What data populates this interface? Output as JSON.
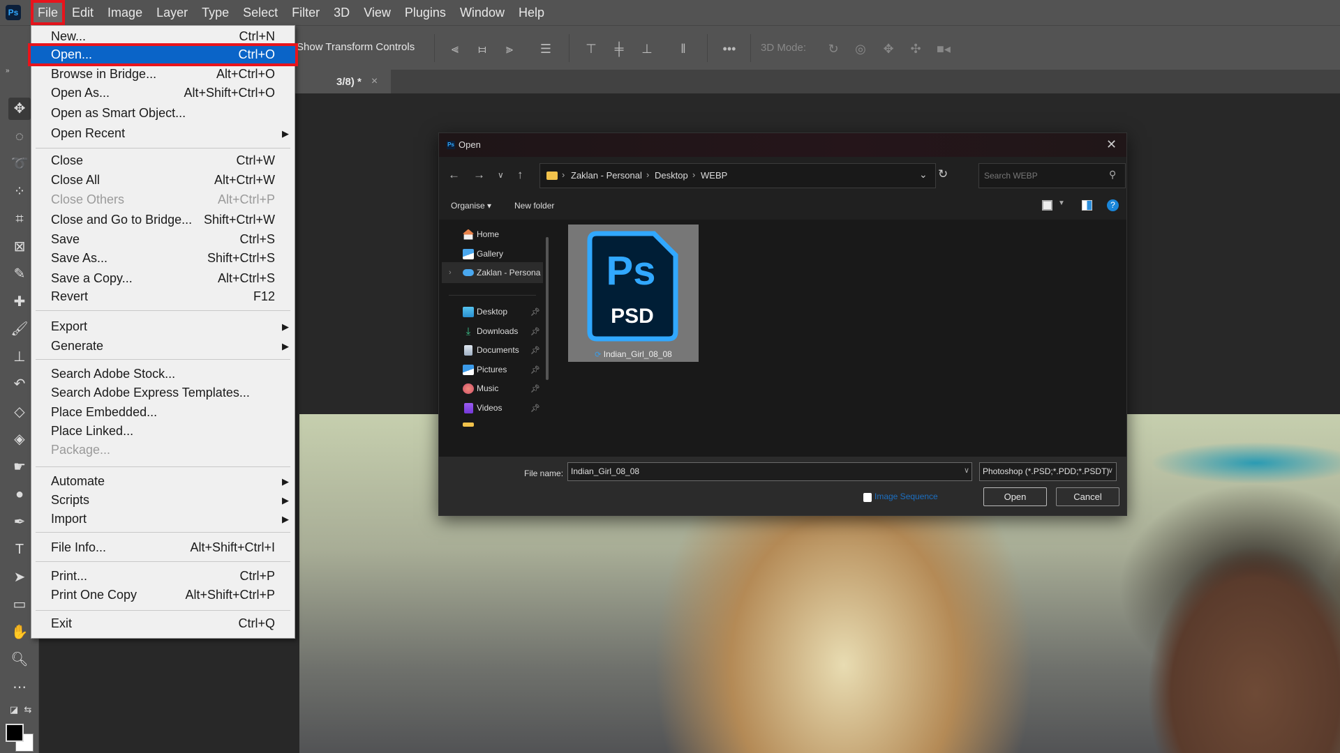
{
  "app": {
    "name": "Adobe Photoshop",
    "logo_text": "Ps"
  },
  "menubar": {
    "items": [
      "File",
      "Edit",
      "Image",
      "Layer",
      "Type",
      "Select",
      "Filter",
      "3D",
      "View",
      "Plugins",
      "Window",
      "Help"
    ],
    "active": "File"
  },
  "options_bar": {
    "show_transform_controls": "Show Transform Controls",
    "more_label": "•••",
    "mode_3d_label": "3D Mode:"
  },
  "document_tab": {
    "title_fragment": "3/8) *",
    "close": "×"
  },
  "file_menu": {
    "items": [
      {
        "label": "New...",
        "shortcut": "Ctrl+N"
      },
      {
        "label": "Open...",
        "shortcut": "Ctrl+O",
        "highlighted": true
      },
      {
        "label": "Browse in Bridge...",
        "shortcut": "Alt+Ctrl+O"
      },
      {
        "label": "Open As...",
        "shortcut": "Alt+Shift+Ctrl+O"
      },
      {
        "label": "Open as Smart Object...",
        "shortcut": ""
      },
      {
        "label": "Open Recent",
        "submenu": true
      },
      {
        "label": "Close",
        "shortcut": "Ctrl+W"
      },
      {
        "label": "Close All",
        "shortcut": "Alt+Ctrl+W"
      },
      {
        "label": "Close Others",
        "shortcut": "Alt+Ctrl+P",
        "disabled": true
      },
      {
        "label": "Close and Go to Bridge...",
        "shortcut": "Shift+Ctrl+W"
      },
      {
        "label": "Save",
        "shortcut": "Ctrl+S"
      },
      {
        "label": "Save As...",
        "shortcut": "Shift+Ctrl+S"
      },
      {
        "label": "Save a Copy...",
        "shortcut": "Alt+Ctrl+S"
      },
      {
        "label": "Revert",
        "shortcut": "F12"
      },
      {
        "label": "Export",
        "submenu": true
      },
      {
        "label": "Generate",
        "submenu": true
      },
      {
        "label": "Search Adobe Stock...",
        "shortcut": ""
      },
      {
        "label": "Search Adobe Express Templates...",
        "shortcut": ""
      },
      {
        "label": "Place Embedded...",
        "shortcut": ""
      },
      {
        "label": "Place Linked...",
        "shortcut": ""
      },
      {
        "label": "Package...",
        "shortcut": "",
        "disabled": true
      },
      {
        "label": "Automate",
        "submenu": true
      },
      {
        "label": "Scripts",
        "submenu": true
      },
      {
        "label": "Import",
        "submenu": true
      },
      {
        "label": "File Info...",
        "shortcut": "Alt+Shift+Ctrl+I"
      },
      {
        "label": "Print...",
        "shortcut": "Ctrl+P"
      },
      {
        "label": "Print One Copy",
        "shortcut": "Alt+Shift+Ctrl+P"
      },
      {
        "label": "Exit",
        "shortcut": "Ctrl+Q"
      }
    ]
  },
  "open_dialog": {
    "title": "Open",
    "breadcrumb": [
      "Zaklan - Personal",
      "Desktop",
      "WEBP"
    ],
    "search_placeholder": "Search WEBP",
    "commands": {
      "organise": "Organise ▾",
      "new_folder": "New folder"
    },
    "nav_items": [
      {
        "label": "Home",
        "icon": "home-icon"
      },
      {
        "label": "Gallery",
        "icon": "gallery-icon"
      },
      {
        "label": "Zaklan - Personal",
        "icon": "onedrive-icon",
        "selected": true
      },
      {
        "label": "Desktop",
        "icon": "desktop-icon",
        "pinned": true
      },
      {
        "label": "Downloads",
        "icon": "downloads-icon",
        "pinned": true
      },
      {
        "label": "Documents",
        "icon": "documents-icon",
        "pinned": true
      },
      {
        "label": "Pictures",
        "icon": "pictures-icon",
        "pinned": true
      },
      {
        "label": "Music",
        "icon": "music-icon",
        "pinned": true
      },
      {
        "label": "Videos",
        "icon": "videos-icon",
        "pinned": true
      }
    ],
    "files": [
      {
        "name": "Indian_Girl_08_08",
        "icon_text_top": "Ps",
        "icon_text_bottom": "PSD",
        "selected": true
      }
    ],
    "file_name_label": "File name:",
    "file_name_value": "Indian_Girl_08_08",
    "file_type_value": "Photoshop (*.PSD;*.PDD;*.PSDT)",
    "image_sequence_label": "Image Sequence",
    "open_button": "Open",
    "cancel_button": "Cancel"
  },
  "colors": {
    "highlight_blue": "#0a64c8",
    "annotation_red": "#e8141c",
    "ps_blue": "#31a8ff",
    "ps_navy": "#001e36"
  }
}
